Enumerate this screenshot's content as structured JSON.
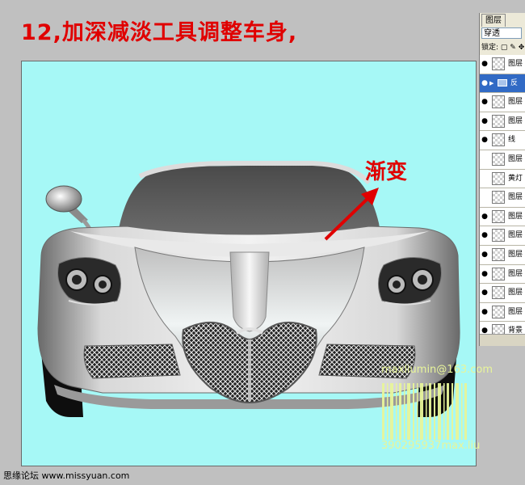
{
  "title": "12,加深减淡工具调整车身,",
  "annotation": "渐变",
  "layers_panel": {
    "tab": "图层",
    "blend_mode": "穿透",
    "lock_label": "锁定:",
    "layers": [
      {
        "name": "图层",
        "visible": true,
        "active": false
      },
      {
        "name": "反",
        "visible": true,
        "active": true
      },
      {
        "name": "图层",
        "visible": true,
        "active": false
      },
      {
        "name": "图层",
        "visible": true,
        "active": false
      },
      {
        "name": "线",
        "visible": true,
        "active": false
      },
      {
        "name": "图层",
        "visible": false,
        "active": false
      },
      {
        "name": "黄灯",
        "visible": false,
        "active": false
      },
      {
        "name": "图层",
        "visible": false,
        "active": false
      },
      {
        "name": "图层",
        "visible": true,
        "active": false
      },
      {
        "name": "图层",
        "visible": true,
        "active": false
      },
      {
        "name": "图层",
        "visible": true,
        "active": false
      },
      {
        "name": "图层",
        "visible": true,
        "active": false
      },
      {
        "name": "图层",
        "visible": true,
        "active": false
      },
      {
        "name": "图层",
        "visible": true,
        "active": false
      },
      {
        "name": "背景",
        "visible": true,
        "active": false
      }
    ]
  },
  "watermark": {
    "line1": "maxliumin@163.com",
    "line2": "390295937max.liu"
  },
  "footer": "思缘论坛 www.missyuan.com",
  "colors": {
    "title_red": "#e00000",
    "canvas_bg": "#a6f8f6",
    "selection_blue": "#316ac5",
    "watermark": "#e8f59a"
  }
}
